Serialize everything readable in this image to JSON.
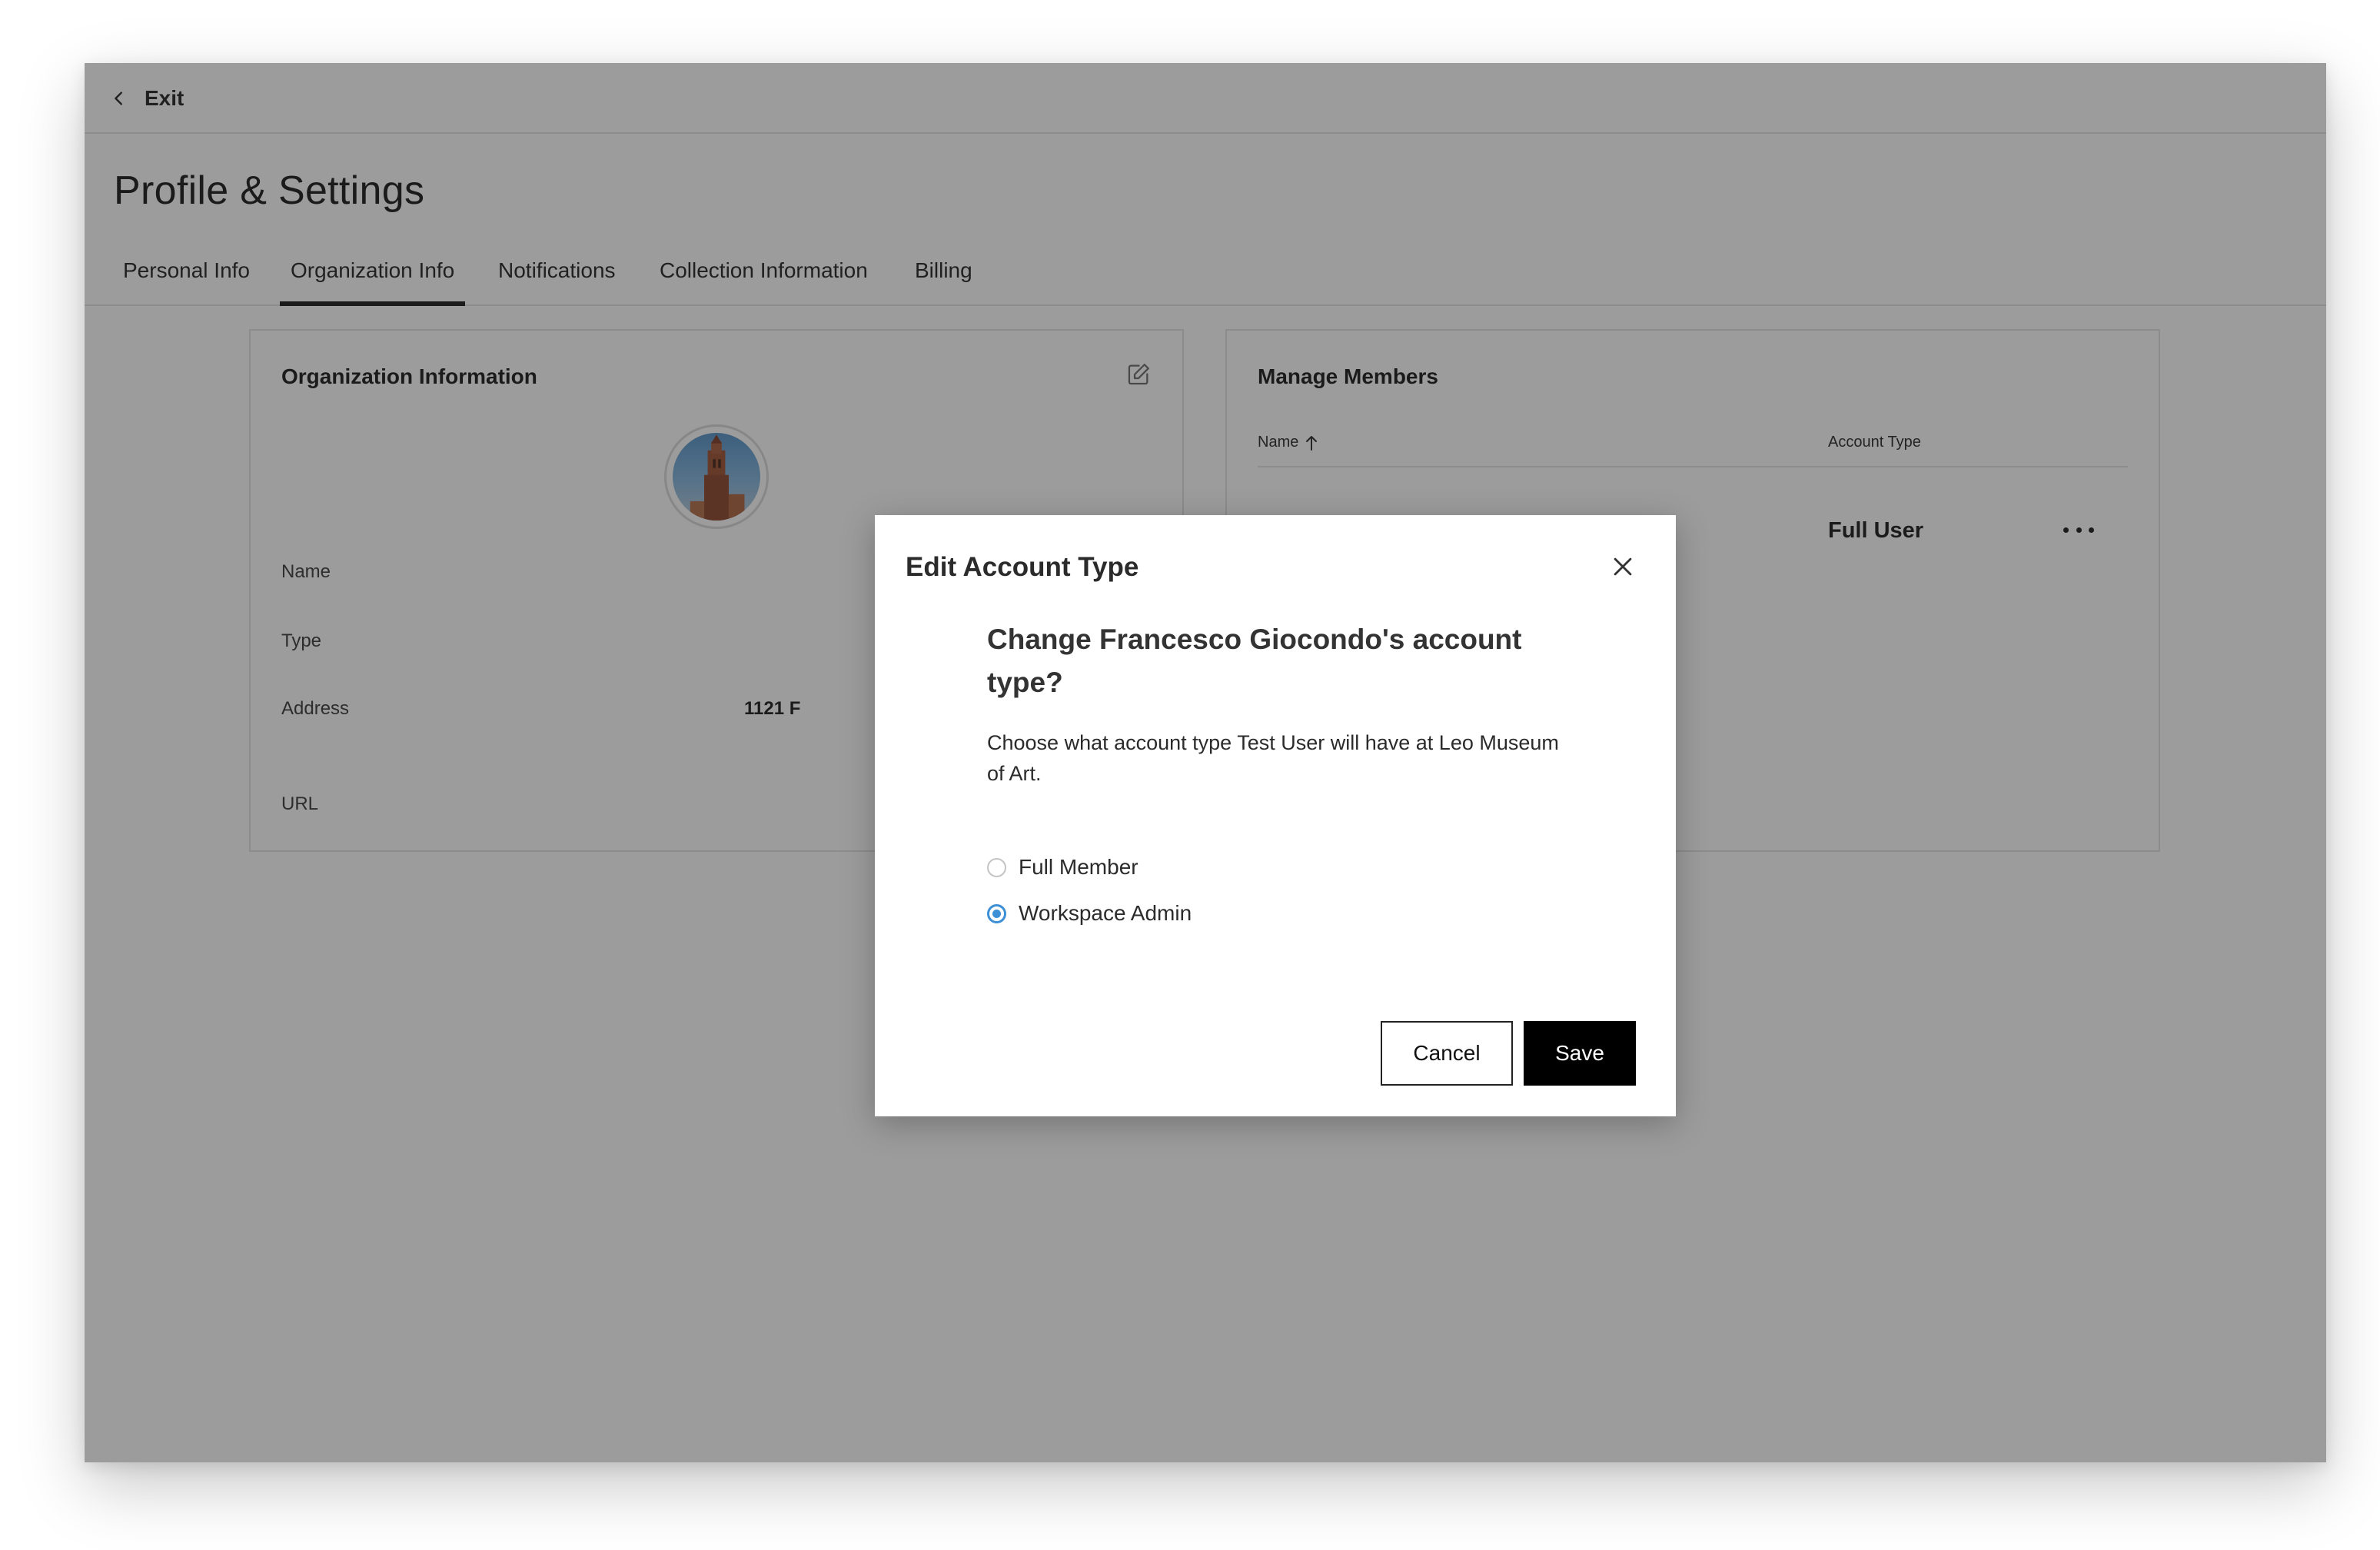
{
  "nav": {
    "exit_label": "Exit"
  },
  "page": {
    "title": "Profile & Settings"
  },
  "tabs": [
    {
      "label": "Personal Info",
      "active": false
    },
    {
      "label": "Organization Info",
      "active": true
    },
    {
      "label": "Notifications",
      "active": false
    },
    {
      "label": "Collection Information",
      "active": false
    },
    {
      "label": "Billing",
      "active": false
    }
  ],
  "org_card": {
    "title": "Organization Information",
    "fields": [
      {
        "label": "Name",
        "value": ""
      },
      {
        "label": "Type",
        "value": ""
      },
      {
        "label": "Address",
        "value": "1121 F"
      },
      {
        "label": "URL",
        "value": ""
      }
    ]
  },
  "members_card": {
    "title": "Manage Members",
    "columns": {
      "name": "Name",
      "account_type": "Account Type"
    },
    "rows": [
      {
        "account_type": "Full User"
      }
    ]
  },
  "modal": {
    "title": "Edit Account Type",
    "heading": "Change Francesco Giocondo's account type?",
    "description": "Choose what account type Test User will have at Leo Museum of Art.",
    "options": [
      {
        "label": "Full Member",
        "selected": false
      },
      {
        "label": "Workspace Admin",
        "selected": true
      }
    ],
    "cancel_label": "Cancel",
    "save_label": "Save"
  },
  "colors": {
    "accent": "#3d8fd6",
    "primary_button": "#000000",
    "overlay": "#8a8a8a"
  }
}
